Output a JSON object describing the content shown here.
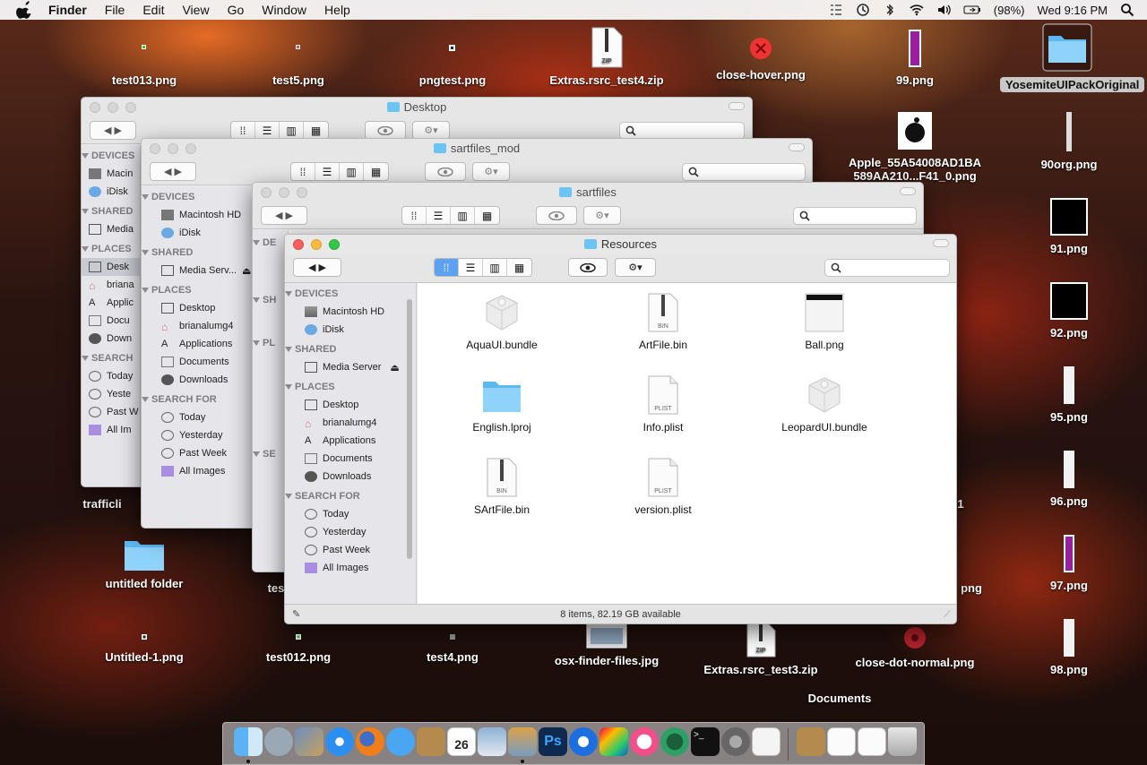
{
  "menubar": {
    "app": "Finder",
    "menus": [
      "File",
      "Edit",
      "View",
      "Go",
      "Window",
      "Help"
    ],
    "battery": "(98%)",
    "clock": "Wed 9:16 PM"
  },
  "desktop_icons": {
    "test013": "test013.png",
    "test5": "test5.png",
    "pngtest": "pngtest.png",
    "extras4": "Extras.rsrc_test4.zip",
    "closehover": "close-hover.png",
    "p99": "99.png",
    "yosemite": "YosemiteUIPackOriginal",
    "apple_line1": "Apple_55A54008AD1BA",
    "apple_line2": "589AA210...F41_0.png",
    "org90": "90org.png",
    "p91": "91.png",
    "p92": "92.png",
    "p95": "95.png",
    "p96": "96.png",
    "p97": "97.png",
    "p98": "98.png",
    "untitled_folder": "untitled folder",
    "untitled1": "Untitled-1.png",
    "test012": "test012.png",
    "test4": "test4.png",
    "osxfinder": "osx-finder-files.jpg",
    "extras3": "Extras.rsrc_test3.zip",
    "closedot": "close-dot-normal.png",
    "documents": "Documents",
    "traffic_partial": "trafficli",
    "test_partial": "tes",
    "png_partial": "png",
    "one_partial": "1"
  },
  "windows": {
    "desktop": {
      "title": "Desktop",
      "sidebar": [
        "DEVICES",
        "Macin",
        "iDisk",
        "SHARED",
        "Media",
        "PLACES",
        "Desk",
        "briana",
        "Applic",
        "Docu",
        "Down",
        "SEARCH",
        "Today",
        "Yeste",
        "Past W",
        "All Im"
      ]
    },
    "sartfiles_mod": {
      "title": "sartfiles_mod",
      "sidebar": {
        "devices": "DEVICES",
        "macintosh": "Macintosh HD",
        "idisk": "iDisk",
        "shared": "SHARED",
        "media": "Media Serv...",
        "places": "PLACES",
        "desktop": "Desktop",
        "home": "brianalumg4",
        "applications": "Applications",
        "documents": "Documents",
        "downloads": "Downloads",
        "search": "SEARCH FOR",
        "today": "Today",
        "yesterday": "Yesterday",
        "pastweek": "Past Week",
        "allimages": "All Images"
      }
    },
    "sartfiles": {
      "title": "sartfiles",
      "sidebar": [
        "DE",
        "SH",
        "PL",
        "SE"
      ]
    },
    "resources": {
      "title": "Resources",
      "sidebar": {
        "devices": "DEVICES",
        "macintosh": "Macintosh HD",
        "idisk": "iDisk",
        "shared": "SHARED",
        "media": "Media Server",
        "places": "PLACES",
        "desktop": "Desktop",
        "home": "brianalumg4",
        "applications": "Applications",
        "documents": "Documents",
        "downloads": "Downloads",
        "search": "SEARCH FOR",
        "today": "Today",
        "yesterday": "Yesterday",
        "pastweek": "Past Week",
        "allimages": "All Images"
      },
      "files": [
        {
          "name": "AquaUI.bundle",
          "icon": "bundle-icon"
        },
        {
          "name": "ArtFile.bin",
          "icon": "bin-file-icon",
          "badge": "BIN"
        },
        {
          "name": "Ball.png",
          "icon": "png-image-icon"
        },
        {
          "name": "English.lproj",
          "icon": "folder-icon"
        },
        {
          "name": "Info.plist",
          "icon": "plist-file-icon",
          "badge": "PLIST"
        },
        {
          "name": "LeopardUI.bundle",
          "icon": "bundle-icon"
        },
        {
          "name": "SArtFile.bin",
          "icon": "bin-file-icon",
          "badge": "BIN"
        },
        {
          "name": "version.plist",
          "icon": "plist-file-icon",
          "badge": "PLIST"
        }
      ],
      "status": "8 items, 82.19 GB available"
    }
  },
  "badges": {
    "zip": "ZIP",
    "bin": "BIN",
    "plist": "PLIST"
  },
  "colors": {
    "accent": "#5ea1f0",
    "folder": "#6cc4f4",
    "close": "#fc605c",
    "minimize": "#fdbc40",
    "zoom": "#34c84a"
  }
}
